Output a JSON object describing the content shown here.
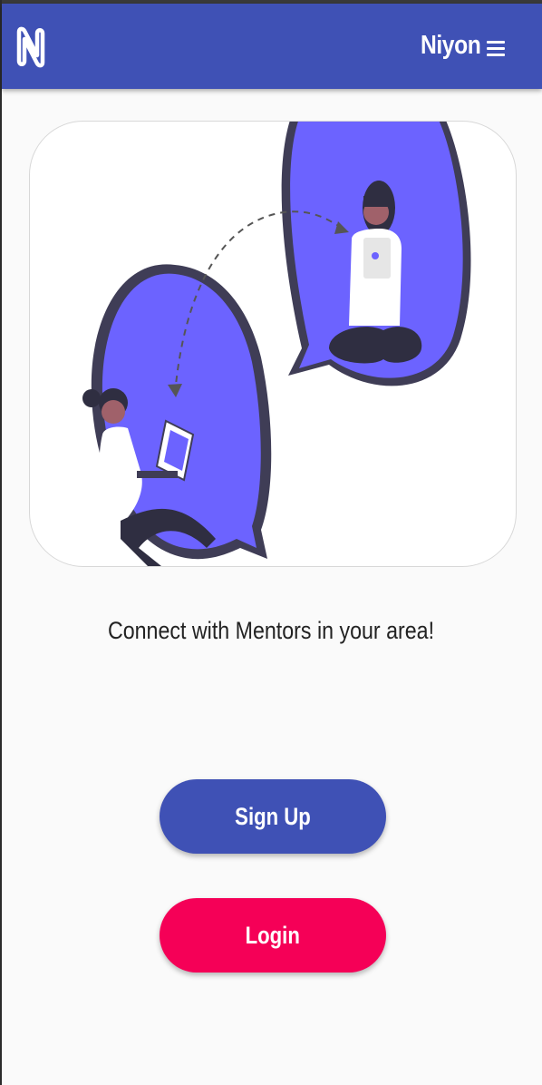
{
  "appbar": {
    "title": "Niyon",
    "logo_icon": "niyon-n-logo-icon",
    "menu_icon": "hamburger-menu-icon",
    "color": "#3f51b5"
  },
  "hero": {
    "illustration": "mentor-connect-illustration",
    "accent_color": "#6c63ff"
  },
  "tagline": "Connect with Mentors in your area!",
  "actions": {
    "signup_label": "Sign Up",
    "login_label": "Login",
    "signup_color": "#3f51b5",
    "login_color": "#f50057"
  }
}
